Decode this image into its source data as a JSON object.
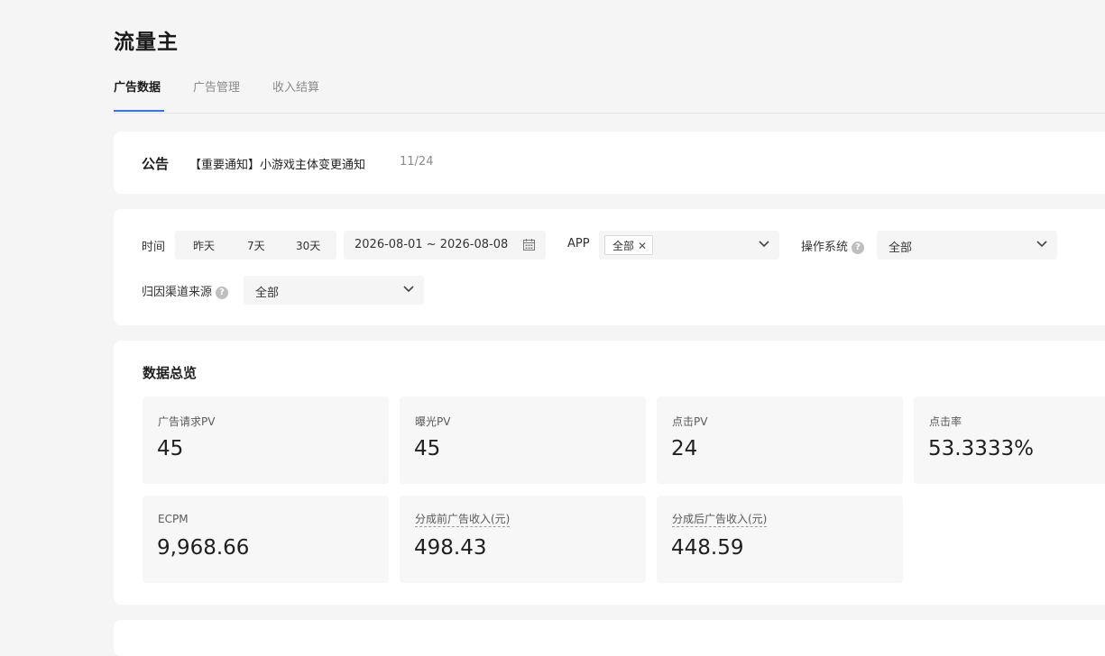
{
  "page": {
    "title": "流量主"
  },
  "tabs": [
    {
      "label": "广告数据",
      "active": true
    },
    {
      "label": "广告管理",
      "active": false
    },
    {
      "label": "收入结算",
      "active": false
    }
  ],
  "notice": {
    "label": "公告",
    "text": "【重要通知】小游戏主体变更通知",
    "pager": "11/24"
  },
  "filters": {
    "time_label": "时间",
    "time_options": [
      "昨天",
      "7天",
      "30天"
    ],
    "date_range": "2026-08-01 ~ 2026-08-08",
    "app_label": "APP",
    "app_tag": "全部",
    "os_label": "操作系统",
    "os_value": "全部",
    "channel_label": "归因渠道来源",
    "channel_value": "全部",
    "help_glyph": "?"
  },
  "overview": {
    "title": "数据总览",
    "stats": [
      {
        "label": "广告请求PV",
        "value": "45"
      },
      {
        "label": "曝光PV",
        "value": "45"
      },
      {
        "label": "点击PV",
        "value": "24"
      },
      {
        "label": "点击率",
        "value": "53.3333%"
      },
      {
        "label": "ECPM",
        "value": "9,968.66"
      },
      {
        "label": "分成前广告收入(元)",
        "value": "498.43"
      },
      {
        "label": "分成后广告收入(元)",
        "value": "448.59"
      }
    ]
  },
  "colors": {
    "accent": "#3370ff",
    "background": "#f5f5f5",
    "card": "#ffffff",
    "stat_bg": "#f7f7f7"
  },
  "icons": {
    "calendar": "calendar-icon",
    "chevron": "chevron-down-icon",
    "close": "close-icon",
    "help": "help-icon"
  }
}
